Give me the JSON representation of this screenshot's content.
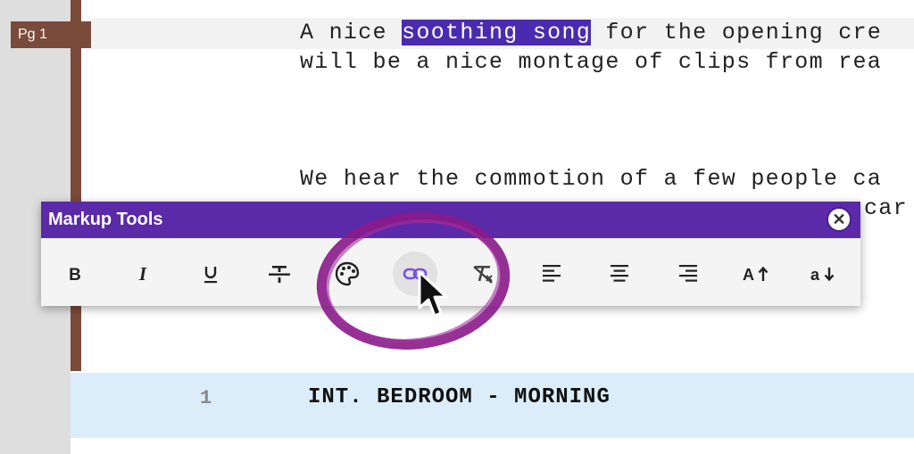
{
  "page_marker": {
    "label": "Pg 1"
  },
  "script": {
    "line1_before": "A nice ",
    "line1_selected": "soothing song",
    "line1_after": " for the opening cre",
    "line2": "will be a nice montage of clips from rea",
    "line3": "We hear the commotion of a few people ca",
    "line4_tail": "car"
  },
  "scene": {
    "number": "1",
    "heading": "INT. BEDROOM - MORNING"
  },
  "toolbar": {
    "title": "Markup Tools",
    "close_icon": "close-icon",
    "tools": [
      {
        "name": "bold",
        "glyph": "B"
      },
      {
        "name": "italic",
        "glyph": "I"
      },
      {
        "name": "underline",
        "glyph": "U"
      },
      {
        "name": "strikethrough",
        "glyph": "S"
      },
      {
        "name": "color-palette",
        "glyph": "palette"
      },
      {
        "name": "link",
        "glyph": "link",
        "active": true
      },
      {
        "name": "clear-format",
        "glyph": "Tx"
      },
      {
        "name": "align-left",
        "glyph": "align-left"
      },
      {
        "name": "align-center",
        "glyph": "align-center"
      },
      {
        "name": "align-right",
        "glyph": "align-right"
      },
      {
        "name": "uppercase",
        "glyph": "A↑"
      },
      {
        "name": "lowercase",
        "glyph": "a↓"
      }
    ]
  },
  "colors": {
    "toolbar_header": "#5a2aa8",
    "selection": "#4a2bb0",
    "margin_bar": "#7a4a3a",
    "scene_row": "#dcedfa",
    "annotation_circle": "#8a1a8a"
  }
}
